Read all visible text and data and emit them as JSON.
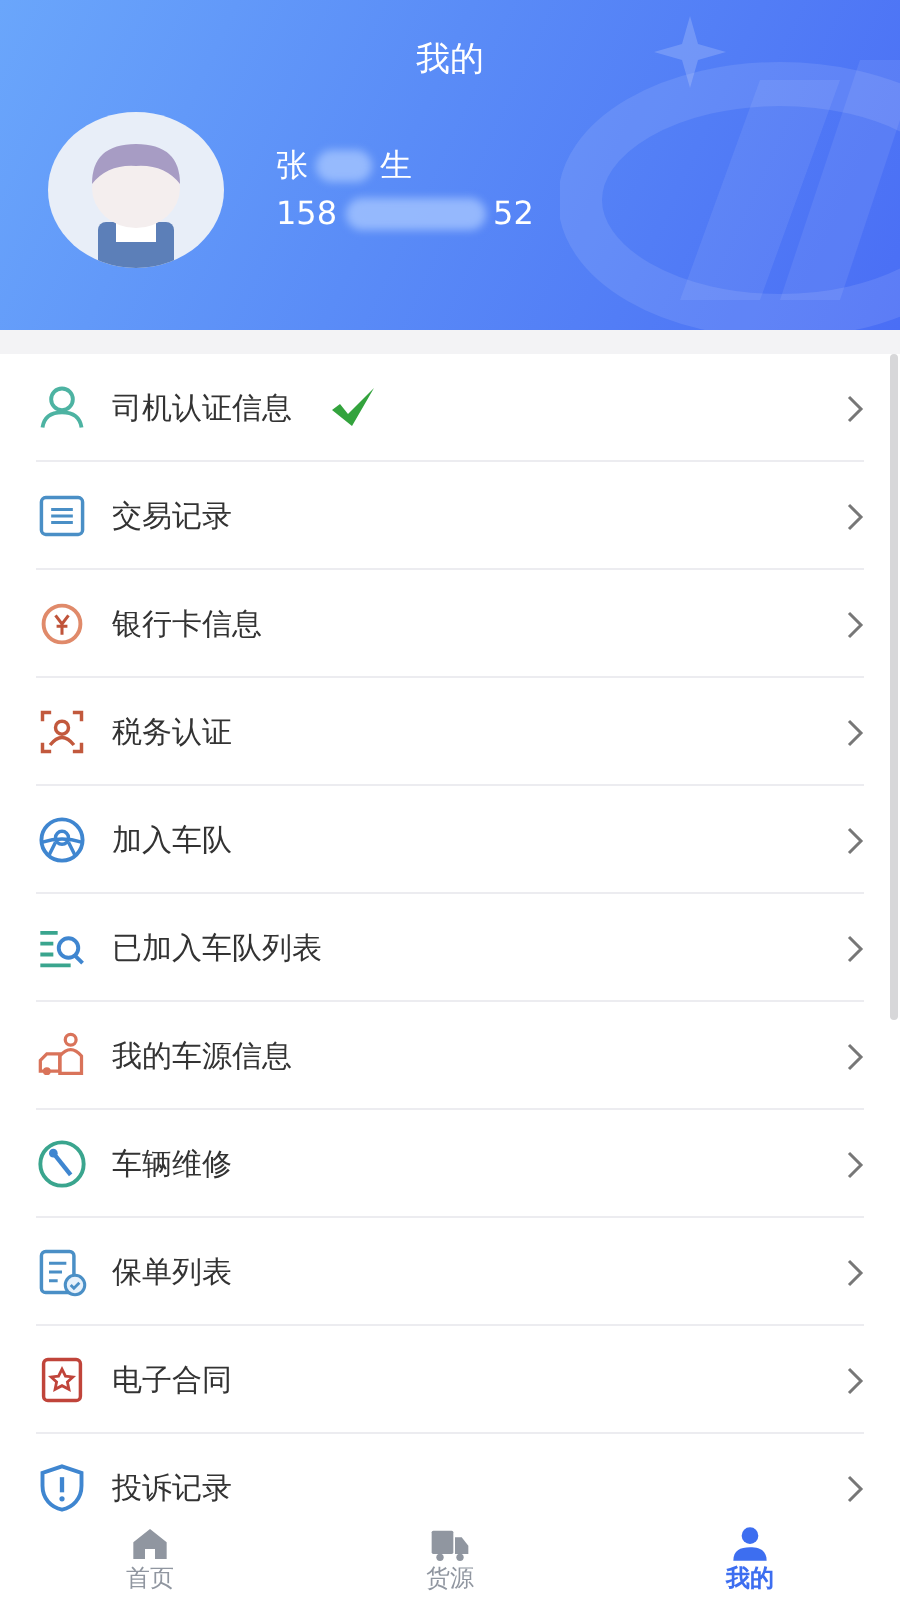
{
  "header": {
    "title": "我的",
    "name": "张",
    "name_tail": "生",
    "phone": "158",
    "phone_tail": "52"
  },
  "menu": [
    {
      "label": "司机认证信息",
      "verified": true
    },
    {
      "label": "交易记录",
      "verified": false
    },
    {
      "label": "银行卡信息",
      "verified": false
    },
    {
      "label": "税务认证",
      "verified": false
    },
    {
      "label": "加入车队",
      "verified": false
    },
    {
      "label": "已加入车队列表",
      "verified": false
    },
    {
      "label": "我的车源信息",
      "verified": false
    },
    {
      "label": "车辆维修",
      "verified": false
    },
    {
      "label": "保单列表",
      "verified": false
    },
    {
      "label": "电子合同",
      "verified": false
    },
    {
      "label": "投诉记录",
      "verified": false
    }
  ],
  "tabs": [
    {
      "label": "首页",
      "selected": false
    },
    {
      "label": "货源",
      "selected": false
    },
    {
      "label": "我的",
      "selected": true
    }
  ]
}
